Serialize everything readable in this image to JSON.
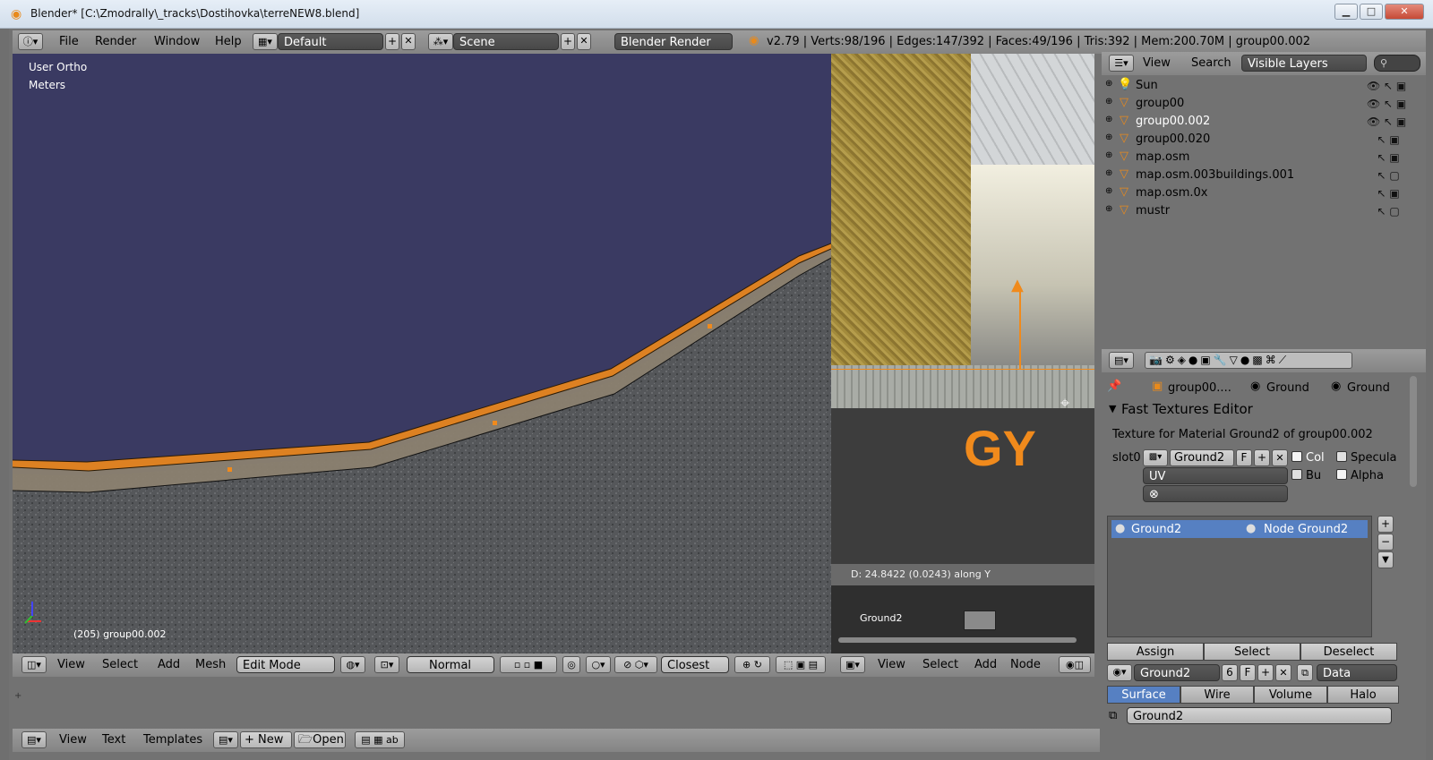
{
  "window": {
    "title": "Blender* [C:\\Zmodrally\\_tracks\\Dostihovka\\terreNEW8.blend]",
    "minimize": "▁",
    "maximize": "□",
    "close": "✕"
  },
  "info_header": {
    "menus": [
      "File",
      "Render",
      "Window",
      "Help"
    ],
    "screen_layout": "Default",
    "scene": "Scene",
    "render_engine": "Blender Render",
    "stats": "v2.79 | Verts:98/196 | Edges:147/392 | Faces:49/196 | Tris:392 | Mem:200.70M | group00.002"
  },
  "viewport": {
    "view_name": "User Ortho",
    "units": "Meters",
    "selected_info": "(205) group00.002",
    "header_menus": [
      "View",
      "Select",
      "Add",
      "Mesh"
    ],
    "mode": "Edit Mode",
    "orientation": "Normal",
    "snap": "Closest"
  },
  "uv_editor": {
    "status": "D: 24.8422 (0.0243) along Y",
    "overlay_text": "GY",
    "node_label": "Ground2",
    "header_menus": [
      "View",
      "Select",
      "Add",
      "Node"
    ]
  },
  "outliner": {
    "menus": [
      "View",
      "Search"
    ],
    "filter": "Visible Layers",
    "items": [
      {
        "name": "Sun",
        "icon": "lamp-icon",
        "selected": false
      },
      {
        "name": "group00",
        "icon": "mesh-icon",
        "selected": false
      },
      {
        "name": "group00.002",
        "icon": "mesh-icon",
        "selected": true
      },
      {
        "name": "group00.020",
        "icon": "mesh-icon",
        "selected": false
      },
      {
        "name": "map.osm",
        "icon": "mesh-icon",
        "selected": false
      },
      {
        "name": "map.osm.003buildings.001",
        "icon": "mesh-icon",
        "selected": false
      },
      {
        "name": "map.osm.0x",
        "icon": "mesh-icon",
        "selected": false
      },
      {
        "name": "mustr",
        "icon": "mesh-icon",
        "selected": false
      }
    ]
  },
  "properties": {
    "breadcrumb": [
      "group00....",
      "Ground",
      "Ground"
    ],
    "panel_title": "Fast Textures Editor",
    "texture_info": "Texture for Material Ground2 of group00.002",
    "slot_label": "slot0",
    "slot_texture": "Ground2",
    "slot_f": "F",
    "col_label": "Col",
    "specular_label": "Specula",
    "bump_label": "Bu",
    "alpha_label": "Alpha",
    "mapping": "UV",
    "material_list": [
      {
        "name": "Ground2",
        "node": "Node Ground2"
      }
    ],
    "assign": "Assign",
    "select": "Select",
    "deselect": "Deselect",
    "material_name": "Ground2",
    "material_users": "6",
    "material_f": "F",
    "data_mode": "Data",
    "tabs": [
      "Surface",
      "Wire",
      "Volume",
      "Halo"
    ],
    "active_tab": "Surface",
    "node_name": "Ground2"
  },
  "text_editor": {
    "menus": [
      "View",
      "Text",
      "Templates"
    ],
    "new_label": "New",
    "open_label": "Open"
  },
  "colors": {
    "accent_orange": "#f08a1c",
    "selection_blue": "#5680c2",
    "viewport_sky": "#3a3a62"
  }
}
